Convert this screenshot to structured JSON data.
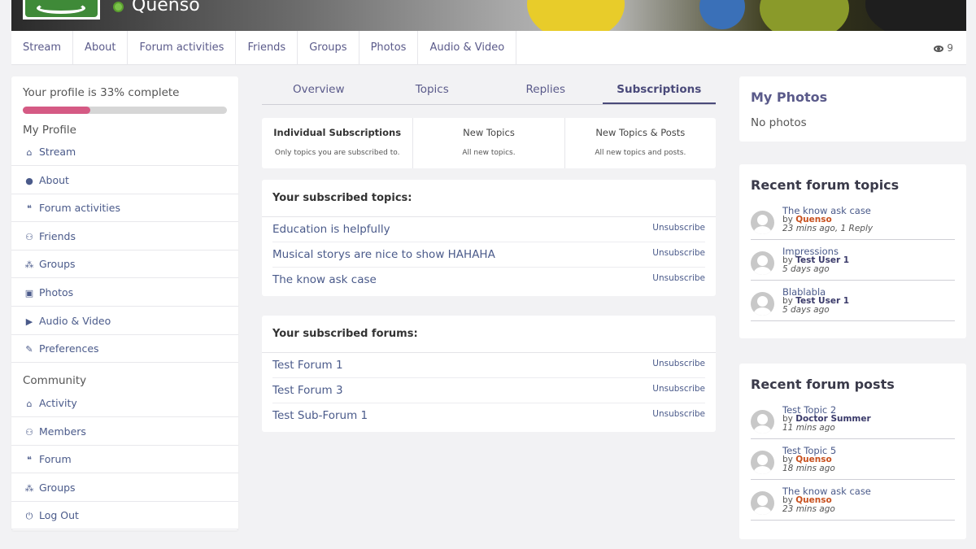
{
  "profile": {
    "name": "Quenso"
  },
  "nav": {
    "items": [
      "Stream",
      "About",
      "Forum activities",
      "Friends",
      "Groups",
      "Photos",
      "Audio & Video"
    ],
    "views": "9"
  },
  "sidebar": {
    "progress_text": "Your profile is 33% complete",
    "progress_percent": 33,
    "my_profile_heading": "My Profile",
    "my_profile_items": [
      {
        "label": "Stream",
        "icon": "home-icon"
      },
      {
        "label": "About",
        "icon": "user-icon"
      },
      {
        "label": "Forum activities",
        "icon": "comments-icon"
      },
      {
        "label": "Friends",
        "icon": "users-icon"
      },
      {
        "label": "Groups",
        "icon": "group-icon"
      },
      {
        "label": "Photos",
        "icon": "camera-icon"
      },
      {
        "label": "Audio & Video",
        "icon": "video-icon"
      },
      {
        "label": "Preferences",
        "icon": "edit-icon"
      }
    ],
    "community_heading": "Community",
    "community_items": [
      {
        "label": "Activity",
        "icon": "home-icon"
      },
      {
        "label": "Members",
        "icon": "users-icon"
      },
      {
        "label": "Forum",
        "icon": "comments-icon"
      },
      {
        "label": "Groups",
        "icon": "group-icon"
      },
      {
        "label": "Log Out",
        "icon": "power-icon"
      }
    ]
  },
  "tabs": [
    "Overview",
    "Topics",
    "Replies",
    "Subscriptions"
  ],
  "subscription_types": [
    {
      "title": "Individual Subscriptions",
      "desc": "Only topics you are subscribed to."
    },
    {
      "title": "New Topics",
      "desc": "All new topics."
    },
    {
      "title": "New Topics & Posts",
      "desc": "All new topics and posts."
    }
  ],
  "subscribed_topics": {
    "heading": "Your subscribed topics:",
    "unsubscribe_label": "Unsubscribe",
    "items": [
      "Education is helpfully",
      "Musical storys are nice to show HAHAHA",
      "The know ask case"
    ]
  },
  "subscribed_forums": {
    "heading": "Your subscribed forums:",
    "unsubscribe_label": "Unsubscribe",
    "items": [
      "Test Forum 1",
      "Test Forum 3",
      "Test Sub-Forum 1"
    ]
  },
  "my_photos": {
    "title": "My Photos",
    "empty": "No photos"
  },
  "recent_topics": {
    "title": "Recent forum topics",
    "by_label": "by",
    "items": [
      {
        "title": "The know ask case",
        "author": "Quenso",
        "author_color": "#c8501e",
        "time": "23 mins ago, 1 Reply"
      },
      {
        "title": "Impressions",
        "author": "Test User 1",
        "author_color": "#3a3a6a",
        "time": "5 days ago"
      },
      {
        "title": "Blablabla",
        "author": "Test User 1",
        "author_color": "#3a3a6a",
        "time": "5 days ago"
      }
    ]
  },
  "recent_posts": {
    "title": "Recent forum posts",
    "by_label": "by",
    "items": [
      {
        "title": "Test Topic 2",
        "author": "Doctor Summer",
        "author_color": "#3a3a6a",
        "time": "11 mins ago"
      },
      {
        "title": "Test Topic 5",
        "author": "Quenso",
        "author_color": "#c8501e",
        "time": "18 mins ago"
      },
      {
        "title": "The know ask case",
        "author": "Quenso",
        "author_color": "#c8501e",
        "time": "23 mins ago"
      }
    ]
  },
  "icon_glyphs": {
    "home-icon": "⌂",
    "user-icon": "●",
    "comments-icon": "❝",
    "users-icon": "⚇",
    "group-icon": "⁂",
    "camera-icon": "▣",
    "video-icon": "▶",
    "edit-icon": "✎",
    "power-icon": "⏻"
  }
}
